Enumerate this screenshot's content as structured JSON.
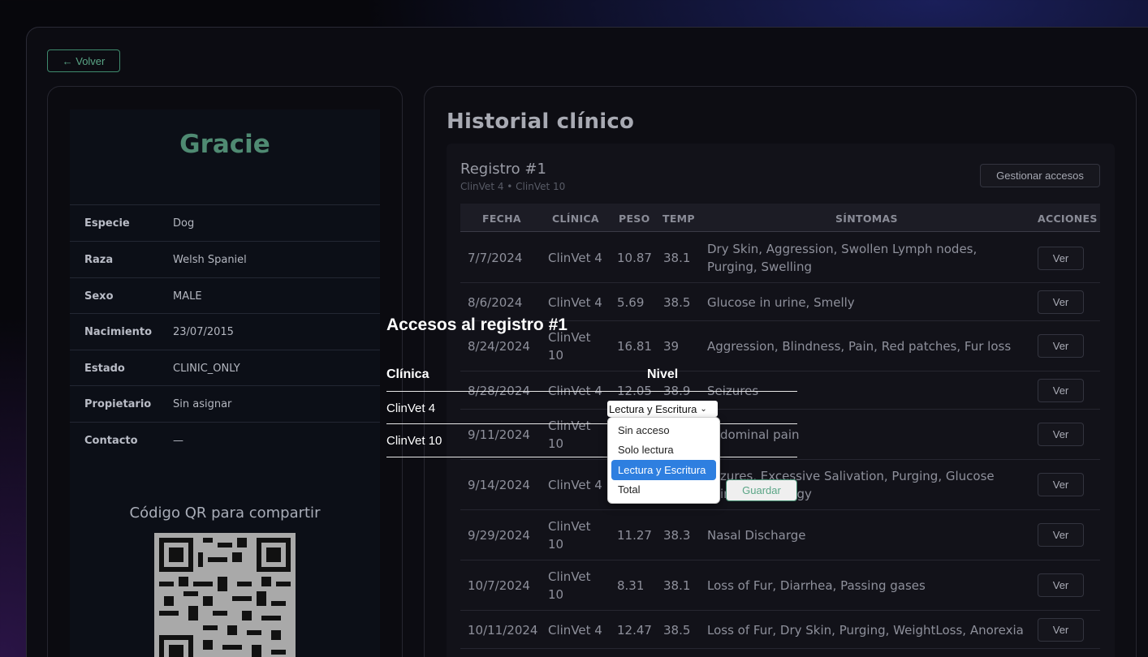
{
  "nav": {
    "back_label": "← Volver"
  },
  "pet": {
    "name": "Gracie",
    "fields": [
      {
        "label": "Especie",
        "value": "Dog"
      },
      {
        "label": "Raza",
        "value": "Welsh Spaniel"
      },
      {
        "label": "Sexo",
        "value": "MALE"
      },
      {
        "label": "Nacimiento",
        "value": "23/07/2015"
      },
      {
        "label": "Estado",
        "value": "CLINIC_ONLY"
      },
      {
        "label": "Propietario",
        "value": "Sin asignar"
      },
      {
        "label": "Contacto",
        "value": "—"
      }
    ],
    "qr_title": "Código QR para compartir"
  },
  "history": {
    "title": "Historial clínico",
    "record": {
      "title": "Registro #1",
      "subtitle": "ClinVet 4 • ClinVet 10",
      "manage_label": "Gestionar accesos"
    },
    "columns": [
      "FECHA",
      "CLÍNICA",
      "PESO",
      "TEMP",
      "SÍNTOMAS",
      "ACCIONES"
    ],
    "view_label": "Ver",
    "rows": [
      {
        "fecha": "7/7/2024",
        "clinica": "ClinVet 4",
        "peso": "10.87",
        "temp": "38.1",
        "sintomas": "Dry Skin, Aggression, Swollen Lymph nodes, Purging, Swelling"
      },
      {
        "fecha": "8/6/2024",
        "clinica": "ClinVet 4",
        "peso": "5.69",
        "temp": "38.5",
        "sintomas": "Glucose in urine, Smelly"
      },
      {
        "fecha": "8/24/2024",
        "clinica": "ClinVet 10",
        "peso": "16.81",
        "temp": "39",
        "sintomas": "Aggression, Blindness, Pain, Red patches, Fur loss"
      },
      {
        "fecha": "8/28/2024",
        "clinica": "ClinVet 4",
        "peso": "12.05",
        "temp": "38.9",
        "sintomas": "Seizures"
      },
      {
        "fecha": "9/11/2024",
        "clinica": "ClinVet 10",
        "peso": "",
        "temp": "",
        "sintomas": "dominal pain"
      },
      {
        "fecha": "9/14/2024",
        "clinica": "ClinVet 4",
        "peso": "",
        "temp": "",
        "sintomas": "zures, Excessive Salivation, Purging, Glucose in ne, Lethargy"
      },
      {
        "fecha": "9/29/2024",
        "clinica": "ClinVet 10",
        "peso": "11.27",
        "temp": "38.3",
        "sintomas": "Nasal Discharge"
      },
      {
        "fecha": "10/7/2024",
        "clinica": "ClinVet 10",
        "peso": "8.31",
        "temp": "38.1",
        "sintomas": "Loss of Fur, Diarrhea, Passing gases"
      },
      {
        "fecha": "10/11/2024",
        "clinica": "ClinVet 4",
        "peso": "12.47",
        "temp": "38.5",
        "sintomas": "Loss of Fur, Dry Skin, Purging, WeightLoss, Anorexia"
      }
    ]
  },
  "access_modal": {
    "title": "Accesos al registro #1",
    "col_clinic": "Clínica",
    "col_level": "Nivel",
    "clinics": [
      "ClinVet 4",
      "ClinVet 10"
    ],
    "selected_level": "Lectura y Escritura",
    "options": [
      "Sin acceso",
      "Solo lectura",
      "Lectura y Escritura",
      "Total"
    ],
    "save_label": "Guardar"
  }
}
